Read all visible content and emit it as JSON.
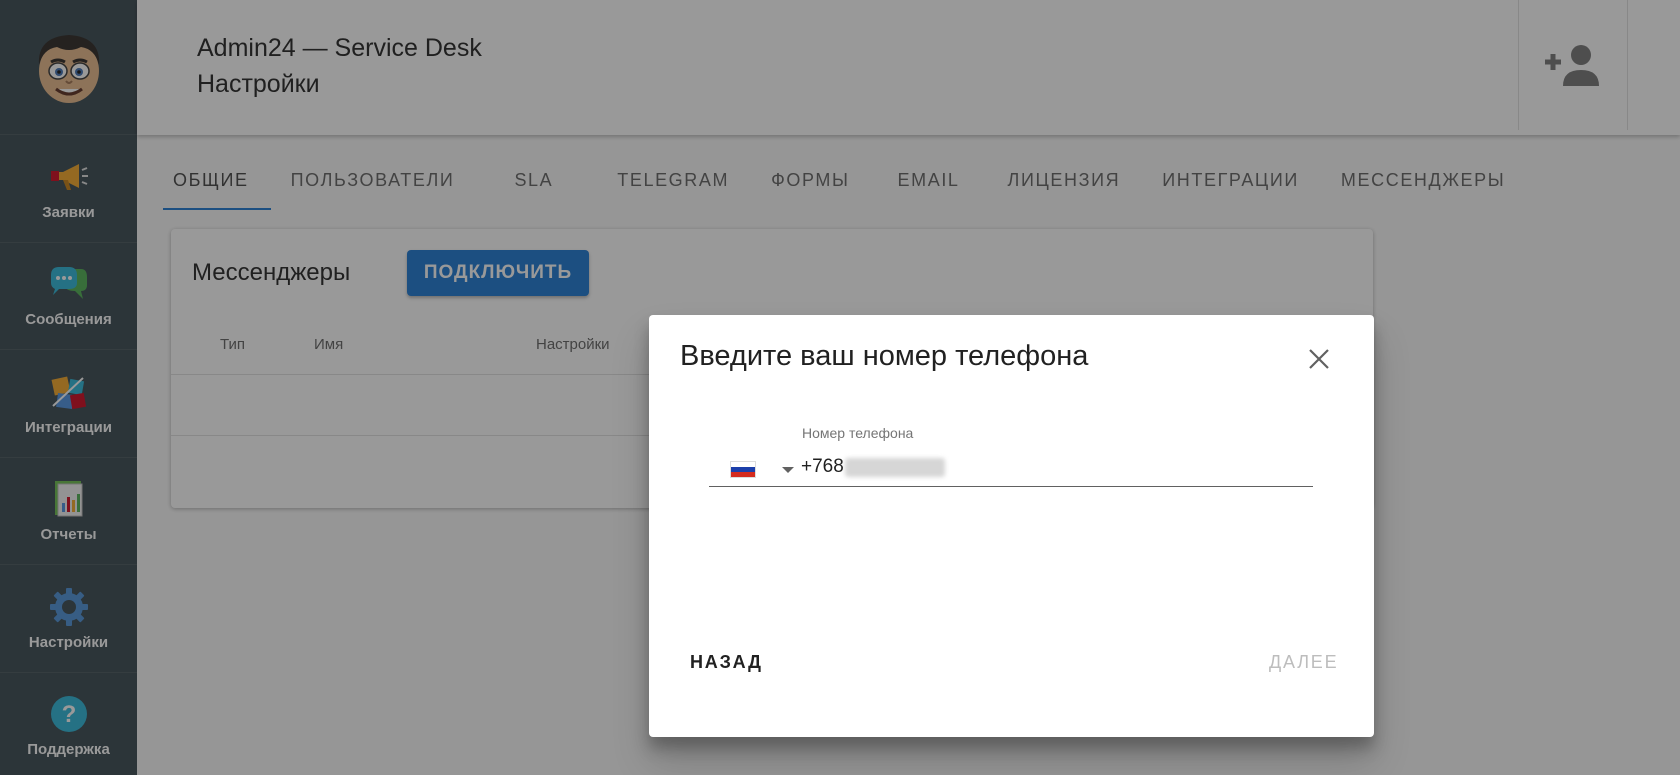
{
  "header": {
    "app_title": "Admin24 — Service Desk",
    "page_title": "Настройки"
  },
  "sidebar": {
    "items": [
      {
        "label": "Заявки",
        "icon": "megaphone-icon"
      },
      {
        "label": "Сообщения",
        "icon": "chat-bubbles-icon"
      },
      {
        "label": "Интеграции",
        "icon": "puzzle-icon"
      },
      {
        "label": "Отчеты",
        "icon": "report-icon"
      },
      {
        "label": "Настройки",
        "icon": "gear-icon"
      },
      {
        "label": "Поддержка",
        "icon": "help-icon"
      }
    ]
  },
  "tabs": [
    {
      "label": "ОБЩИЕ",
      "active": true
    },
    {
      "label": "ПОЛЬЗОВАТЕЛИ"
    },
    {
      "label": "SLA"
    },
    {
      "label": "TELEGRAM"
    },
    {
      "label": "ФОРМЫ"
    },
    {
      "label": "EMAIL"
    },
    {
      "label": "ЛИЦЕНЗИЯ"
    },
    {
      "label": "ИНТЕГРАЦИИ"
    },
    {
      "label": "МЕССЕНДЖЕРЫ"
    }
  ],
  "card": {
    "title": "Мессенджеры",
    "connect_label": "ПОДКЛЮЧИТЬ",
    "columns": [
      "Тип",
      "Имя",
      "Настройки"
    ]
  },
  "dialog": {
    "title": "Введите ваш номер телефона",
    "phone_label": "Номер телефона",
    "phone_value": "+768",
    "country": "RU",
    "back_label": "НАЗАД",
    "next_label": "ДАЛЕЕ"
  },
  "colors": {
    "sidebar_bg": "#37474f",
    "accent": "#1976d2",
    "overlay": "rgba(33,33,33,0.46)"
  }
}
